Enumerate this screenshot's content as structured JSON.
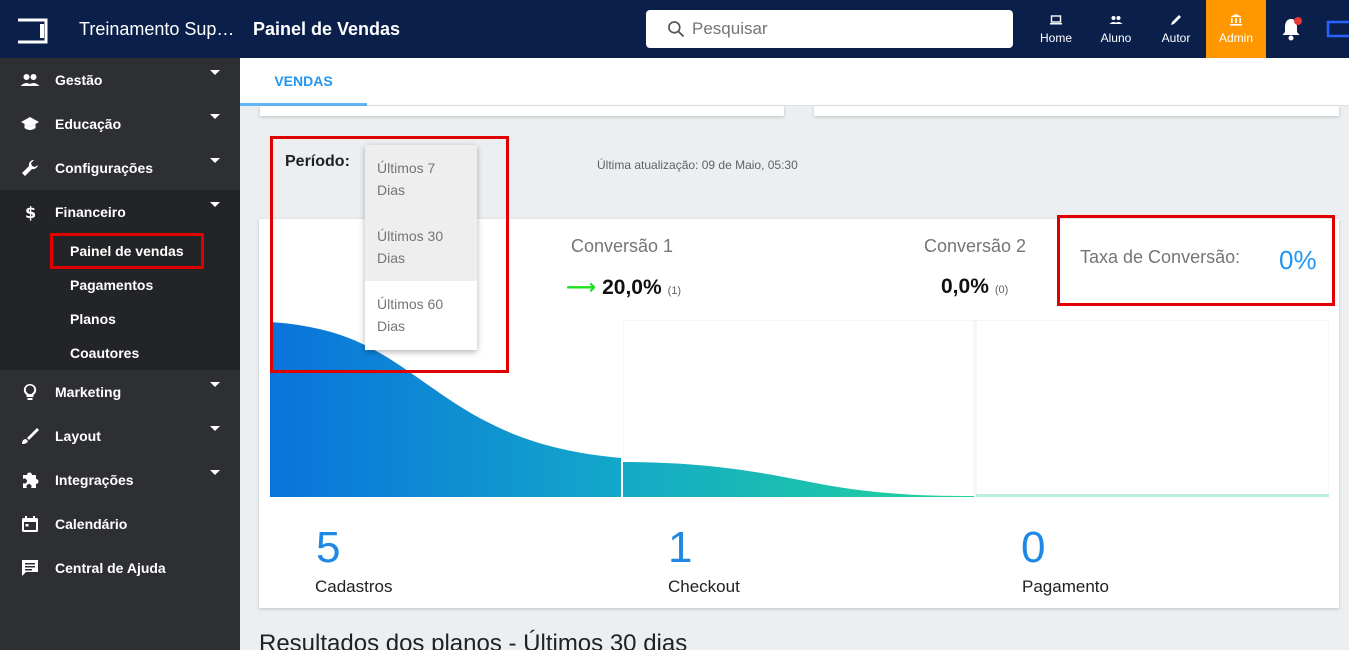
{
  "header": {
    "brand": "Treinamento Suporte",
    "page_title": "Painel de Vendas",
    "search_placeholder": "Pesquisar",
    "nav": [
      {
        "label": "Home"
      },
      {
        "label": "Aluno"
      },
      {
        "label": "Autor"
      },
      {
        "label": "Admin"
      }
    ],
    "admin_color": "#ff9800",
    "bar_color": "#0b1f4b"
  },
  "sidebar": {
    "items": [
      {
        "label": "Gestão",
        "icon": "people-icon"
      },
      {
        "label": "Educação",
        "icon": "graduation-cap-icon"
      },
      {
        "label": "Configurações",
        "icon": "wrench-icon"
      },
      {
        "label": "Financeiro",
        "icon": "dollar-icon"
      },
      {
        "label": "Marketing",
        "icon": "lightbulb-icon"
      },
      {
        "label": "Layout",
        "icon": "brush-icon"
      },
      {
        "label": "Integrações",
        "icon": "puzzle-icon"
      },
      {
        "label": "Calendário",
        "icon": "calendar-icon"
      },
      {
        "label": "Central de Ajuda",
        "icon": "chat-icon"
      }
    ],
    "financeiro_sub": [
      {
        "label": "Painel de vendas"
      },
      {
        "label": "Pagamentos"
      },
      {
        "label": "Planos"
      },
      {
        "label": "Coautores"
      }
    ]
  },
  "tabs": [
    {
      "label": "VENDAS"
    }
  ],
  "periodo": {
    "label": "Período:",
    "options": [
      "Últimos 7 Dias",
      "Últimos 30 Dias",
      "Últimos 60 Dias"
    ],
    "last_update": "Última atualização: 09 de Maio, 05:30"
  },
  "conversao": {
    "c1_label": "Conversão 1",
    "c1_value": "20,0%",
    "c1_count": "(1)",
    "c2_label": "Conversão 2",
    "c2_value": "0,0%",
    "c2_count": "(0)",
    "taxa_label": "Taxa de Conversão:",
    "taxa_value": "0%"
  },
  "funnel": {
    "stats": [
      {
        "value": "5",
        "label": "Cadastros"
      },
      {
        "value": "1",
        "label": "Checkout"
      },
      {
        "value": "0",
        "label": "Pagamento"
      }
    ]
  },
  "results_title": "Resultados dos planos - Últimos 30 dias"
}
